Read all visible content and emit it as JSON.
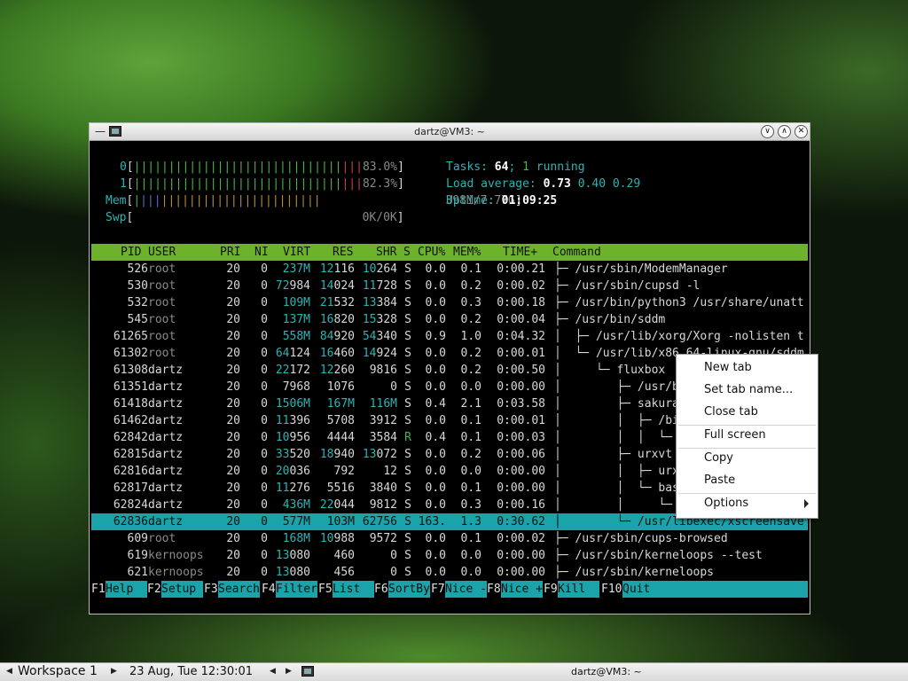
{
  "window": {
    "title": "dartz@VM3: ~"
  },
  "meters": {
    "cpu0": {
      "label": "0",
      "bar_green": "||||||||||||||||||||||||||||||",
      "bar_red": "|||",
      "value": "83.0%"
    },
    "cpu1": {
      "label": "1",
      "bar_green": "||||||||||||||||||||||||||||||",
      "bar_red": "|||",
      "value": "82.3%"
    },
    "mem": {
      "label": "Mem",
      "bar_green": "|",
      "bar_blue": "|||",
      "bar_brown": "|||||||||||||||||||||||",
      "value": "398M/7.77G"
    },
    "swp": {
      "label": "Swp",
      "value": "0K/0K"
    }
  },
  "summary": {
    "tasks_label": "Tasks:",
    "tasks_count": "64",
    "tasks_sep": ";",
    "running_count": "1",
    "running_label": "running",
    "load_label": "Load average:",
    "load_1": "0.73",
    "load_5": "0.40",
    "load_15": "0.29",
    "uptime_label": "Uptime:",
    "uptime_value": "01:09:25"
  },
  "columns": {
    "pid": "PID",
    "user": "USER",
    "pri": "PRI",
    "ni": "NI",
    "virt": "VIRT",
    "res": "RES",
    "shr": "SHR",
    "s": "S",
    "cpu": "CPU%",
    "mem": "MEM%",
    "time": "TIME+",
    "command": "Command"
  },
  "processes": [
    {
      "pid": "526",
      "user": "root",
      "pri": "20",
      "ni": "0",
      "virt_hi": "237M",
      "virt_lo": "",
      "res_hi": "12",
      "res_lo": "116",
      "shr_hi": "10",
      "shr_lo": "264",
      "s": "S",
      "cpu": "0.0",
      "mem": "0.1",
      "time": "0:00.21",
      "command": "├─ /usr/sbin/ModemManager"
    },
    {
      "pid": "530",
      "user": "root",
      "pri": "20",
      "ni": "0",
      "virt_hi": "72",
      "virt_lo": "984",
      "res_hi": "14",
      "res_lo": "024",
      "shr_hi": "11",
      "shr_lo": "728",
      "s": "S",
      "cpu": "0.0",
      "mem": "0.2",
      "time": "0:00.02",
      "command": "├─ /usr/sbin/cupsd -l"
    },
    {
      "pid": "532",
      "user": "root",
      "pri": "20",
      "ni": "0",
      "virt_hi": "109M",
      "virt_lo": "",
      "res_hi": "21",
      "res_lo": "532",
      "shr_hi": "13",
      "shr_lo": "384",
      "s": "S",
      "cpu": "0.0",
      "mem": "0.3",
      "time": "0:00.18",
      "command": "├─ /usr/bin/python3 /usr/share/unatt"
    },
    {
      "pid": "545",
      "user": "root",
      "pri": "20",
      "ni": "0",
      "virt_hi": "137M",
      "virt_lo": "",
      "res_hi": "16",
      "res_lo": "820",
      "shr_hi": "15",
      "shr_lo": "328",
      "s": "S",
      "cpu": "0.0",
      "mem": "0.2",
      "time": "0:00.04",
      "command": "├─ /usr/bin/sddm"
    },
    {
      "pid": "61265",
      "user": "root",
      "pri": "20",
      "ni": "0",
      "virt_hi": "558M",
      "virt_lo": "",
      "res_hi": "84",
      "res_lo": "920",
      "shr_hi": "54",
      "shr_lo": "340",
      "s": "S",
      "cpu": "0.9",
      "mem": "1.0",
      "time": "0:04.32",
      "command": "│  ├─ /usr/lib/xorg/Xorg -nolisten t"
    },
    {
      "pid": "61302",
      "user": "root",
      "pri": "20",
      "ni": "0",
      "virt_hi": "64",
      "virt_lo": "124",
      "res_hi": "16",
      "res_lo": "460",
      "shr_hi": "14",
      "shr_lo": "924",
      "s": "S",
      "cpu": "0.0",
      "mem": "0.2",
      "time": "0:00.01",
      "command": "│  └─ /usr/lib/x86_64-linux-gnu/sddm"
    },
    {
      "pid": "61308",
      "user": "dartz",
      "pri": "20",
      "ni": "0",
      "virt_hi": "22",
      "virt_lo": "172",
      "res_hi": "12",
      "res_lo": "260",
      "shr_hi": "",
      "shr_lo": "9816",
      "s": "S",
      "cpu": "0.0",
      "mem": "0.2",
      "time": "0:00.50",
      "command": "│     └─ fluxbox"
    },
    {
      "pid": "61351",
      "user": "dartz",
      "pri": "20",
      "ni": "0",
      "virt_hi": "",
      "virt_lo": "7968",
      "res_hi": "",
      "res_lo": "1076",
      "shr_hi": "",
      "shr_lo": "0",
      "s": "S",
      "cpu": "0.0",
      "mem": "0.0",
      "time": "0:00.00",
      "command": "│        ├─ /usr/b"
    },
    {
      "pid": "61418",
      "user": "dartz",
      "pri": "20",
      "ni": "0",
      "virt_hi": "1506M",
      "virt_lo": "",
      "res_hi": "167M",
      "res_lo": "",
      "shr_hi": "116M",
      "shr_lo": "",
      "s": "S",
      "cpu": "0.4",
      "mem": "2.1",
      "time": "0:03.58",
      "command": "│        ├─ sakura"
    },
    {
      "pid": "61462",
      "user": "dartz",
      "pri": "20",
      "ni": "0",
      "virt_hi": "11",
      "virt_lo": "396",
      "res_hi": "",
      "res_lo": "5708",
      "shr_hi": "",
      "shr_lo": "3912",
      "s": "S",
      "cpu": "0.0",
      "mem": "0.1",
      "time": "0:00.01",
      "command": "│        │  ├─ /bi"
    },
    {
      "pid": "62842",
      "user": "dartz",
      "pri": "20",
      "ni": "0",
      "virt_hi": "10",
      "virt_lo": "956",
      "res_hi": "",
      "res_lo": "4444",
      "shr_hi": "",
      "shr_lo": "3584",
      "s": "R",
      "cpu": "0.4",
      "mem": "0.1",
      "time": "0:00.03",
      "command": "│        │  │  └─"
    },
    {
      "pid": "62815",
      "user": "dartz",
      "pri": "20",
      "ni": "0",
      "virt_hi": "33",
      "virt_lo": "520",
      "res_hi": "18",
      "res_lo": "940",
      "shr_hi": "13",
      "shr_lo": "072",
      "s": "S",
      "cpu": "0.0",
      "mem": "0.2",
      "time": "0:00.06",
      "command": "│        ├─ urxvt"
    },
    {
      "pid": "62816",
      "user": "dartz",
      "pri": "20",
      "ni": "0",
      "virt_hi": "20",
      "virt_lo": "036",
      "res_hi": "",
      "res_lo": "792",
      "shr_hi": "",
      "shr_lo": "12",
      "s": "S",
      "cpu": "0.0",
      "mem": "0.0",
      "time": "0:00.00",
      "command": "│        │  ├─ urx"
    },
    {
      "pid": "62817",
      "user": "dartz",
      "pri": "20",
      "ni": "0",
      "virt_hi": "11",
      "virt_lo": "276",
      "res_hi": "",
      "res_lo": "5516",
      "shr_hi": "",
      "shr_lo": "3840",
      "s": "S",
      "cpu": "0.0",
      "mem": "0.1",
      "time": "0:00.00",
      "command": "│        │  └─ bas"
    },
    {
      "pid": "62824",
      "user": "dartz",
      "pri": "20",
      "ni": "0",
      "virt_hi": "436M",
      "virt_lo": "",
      "res_hi": "22",
      "res_lo": "044",
      "shr_hi": "",
      "shr_lo": "9812",
      "s": "S",
      "cpu": "0.0",
      "mem": "0.3",
      "time": "0:00.16",
      "command": "│        │     └─"
    },
    {
      "pid": "62836",
      "user": "dartz",
      "pri": "20",
      "ni": "0",
      "virt_hi": "577M",
      "virt_lo": "",
      "res_hi": "103M",
      "res_lo": "",
      "shr_hi": "62",
      "shr_lo": "756",
      "s": "S",
      "cpu": "163.",
      "mem": "1.3",
      "time": "0:30.62",
      "command": "│        └─ /usr/libexec/xscreensave",
      "selected": true
    },
    {
      "pid": "609",
      "user": "root",
      "pri": "20",
      "ni": "0",
      "virt_hi": "168M",
      "virt_lo": "",
      "res_hi": "10",
      "res_lo": "988",
      "shr_hi": "",
      "shr_lo": "9572",
      "s": "S",
      "cpu": "0.0",
      "mem": "0.1",
      "time": "0:00.02",
      "command": "├─ /usr/sbin/cups-browsed"
    },
    {
      "pid": "619",
      "user": "kernoops",
      "pri": "20",
      "ni": "0",
      "virt_hi": "13",
      "virt_lo": "080",
      "res_hi": "",
      "res_lo": "460",
      "shr_hi": "",
      "shr_lo": "0",
      "s": "S",
      "cpu": "0.0",
      "mem": "0.0",
      "time": "0:00.00",
      "command": "├─ /usr/sbin/kerneloops --test"
    },
    {
      "pid": "621",
      "user": "kernoops",
      "pri": "20",
      "ni": "0",
      "virt_hi": "13",
      "virt_lo": "080",
      "res_hi": "",
      "res_lo": "456",
      "shr_hi": "",
      "shr_lo": "0",
      "s": "S",
      "cpu": "0.0",
      "mem": "0.0",
      "time": "0:00.00",
      "command": "├─ /usr/sbin/kerneloops"
    }
  ],
  "fkeys": [
    {
      "key": "F1",
      "label": "Help  "
    },
    {
      "key": "F2",
      "label": "Setup "
    },
    {
      "key": "F3",
      "label": "Search"
    },
    {
      "key": "F4",
      "label": "Filter"
    },
    {
      "key": "F5",
      "label": "List  "
    },
    {
      "key": "F6",
      "label": "SortBy"
    },
    {
      "key": "F7",
      "label": "Nice -"
    },
    {
      "key": "F8",
      "label": "Nice +"
    },
    {
      "key": "F9",
      "label": "Kill  "
    },
    {
      "key": "F10",
      "label": "Quit"
    }
  ],
  "context_menu": {
    "new_tab": "New tab",
    "set_tab_name": "Set tab name...",
    "close_tab": "Close tab",
    "full_screen": "Full screen",
    "copy": "Copy",
    "paste": "Paste",
    "options": "Options"
  },
  "taskbar": {
    "workspace": "Workspace 1",
    "datetime": "23 Aug, Tue 12:30:01",
    "task_title": "dartz@VM3: ~"
  },
  "colors": {
    "header_green": "#6cb32b",
    "selection_cyan": "#1aa3a8",
    "meter_cyan": "#2db3b3"
  }
}
